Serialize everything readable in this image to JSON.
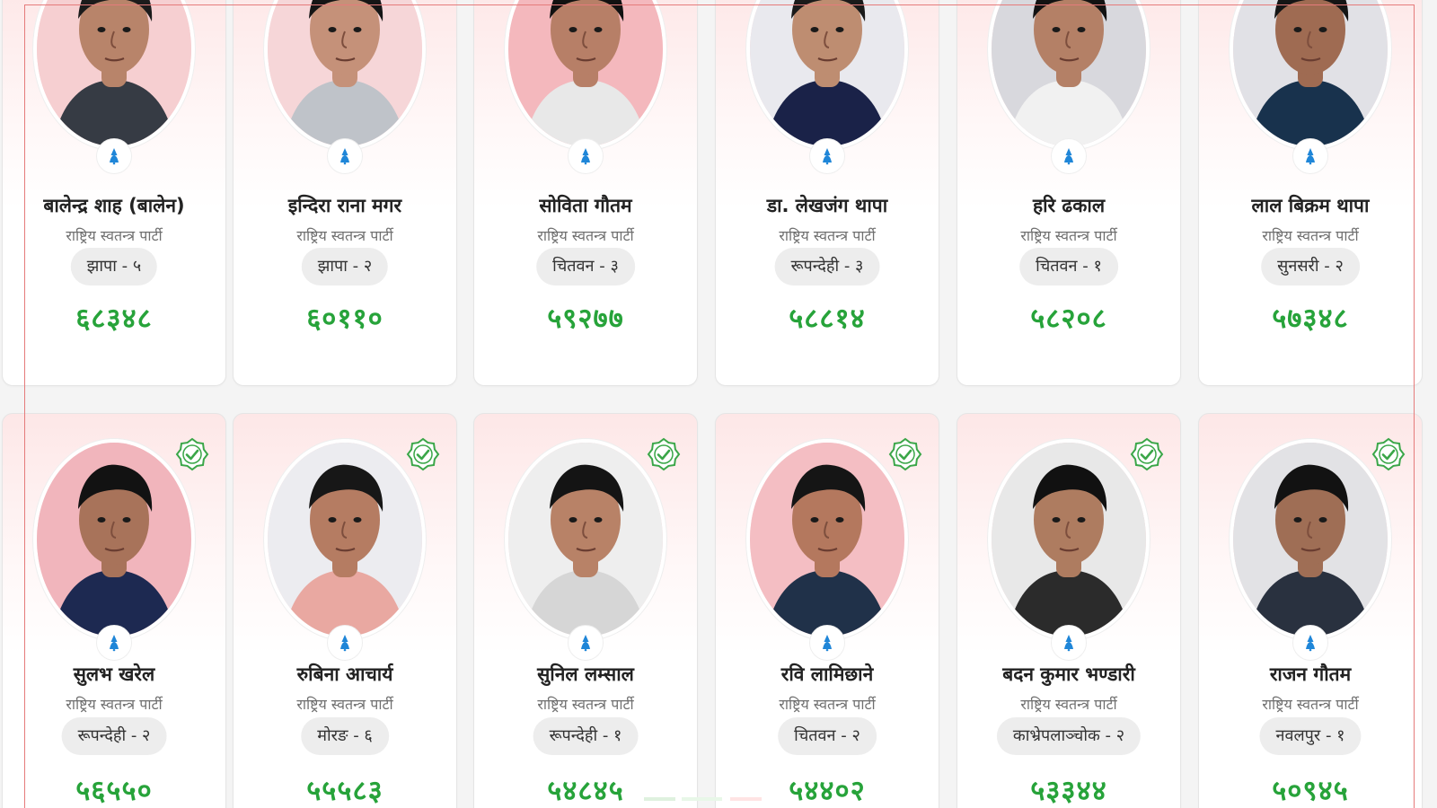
{
  "colors": {
    "card_tint": "#fde7e7",
    "vote_green": "#27a33a",
    "badge_bg": "#ededed",
    "verified_green": "#3aa648",
    "party_blue": "#1f86d8",
    "frame_red": "#e57b7b"
  },
  "cards": [
    {
      "name": "बालेन्द्र शाह (बालेन)",
      "party": "राष्ट्रिय स्वतन्त्र पार्टी",
      "constituency": "झापा - ५",
      "votes": "६८३४८",
      "photo_bg": "#f6cfd1",
      "skin": "#b8846a",
      "hair": "#1b1b1b",
      "shirt": "#363b44"
    },
    {
      "name": "इन्दिरा राना मगर",
      "party": "राष्ट्रिय स्वतन्त्र पार्टी",
      "constituency": "झापा - २",
      "votes": "६०११०",
      "photo_bg": "#f6d6d8",
      "skin": "#c59179",
      "hair": "#151515",
      "shirt": "#bfc3c9"
    },
    {
      "name": "सोविता गौतम",
      "party": "राष्ट्रिय स्वतन्त्र पार्टी",
      "constituency": "चितवन - ३",
      "votes": "५९२७७",
      "photo_bg": "#f4b8bd",
      "skin": "#b77f67",
      "hair": "#111111",
      "shirt": "#e8e8e8"
    },
    {
      "name": "डा. लेखजंग थापा",
      "party": "राष्ट्रिय स्वतन्त्र पार्टी",
      "constituency": "रूपन्देही - ३",
      "votes": "५८८१४",
      "photo_bg": "#e9e9ee",
      "skin": "#be8d71",
      "hair": "#1a1a1a",
      "shirt": "#1a2248"
    },
    {
      "name": "हरि ढकाल",
      "party": "राष्ट्रिय स्वतन्त्र पार्टी",
      "constituency": "चितवन - १",
      "votes": "५८२०८",
      "photo_bg": "#d8d8dd",
      "skin": "#b48066",
      "hair": "#121212",
      "shirt": "#f1f1f1"
    },
    {
      "name": "लाल बिक्रम थापा",
      "party": "राष्ट्रिय स्वतन्त्र पार्टी",
      "constituency": "सुनसरी - २",
      "votes": "५७३४८",
      "photo_bg": "#e1e1e6",
      "skin": "#9f6b52",
      "hair": "#151515",
      "shirt": "#18324d"
    },
    {
      "name": "सुलभ खरेल",
      "party": "राष्ट्रिय स्वतन्त्र पार्टी",
      "constituency": "रूपन्देही - २",
      "votes": "५६५५०",
      "photo_bg": "#f1b5bc",
      "skin": "#a8735a",
      "hair": "#121212",
      "shirt": "#1d2951"
    },
    {
      "name": "रुबिना आचार्य",
      "party": "राष्ट्रिय स्वतन्त्र पार्टी",
      "constituency": "मोरङ - ६",
      "votes": "५५५८३",
      "photo_bg": "#ececf0",
      "skin": "#b57c62",
      "hair": "#171717",
      "shirt": "#e9a8a1"
    },
    {
      "name": "सुनिल लम्साल",
      "party": "राष्ट्रिय स्वतन्त्र पार्टी",
      "constituency": "रूपन्देही - १",
      "votes": "५४८४५",
      "photo_bg": "#eeeeee",
      "skin": "#b88267",
      "hair": "#141414",
      "shirt": "#d6d6d6"
    },
    {
      "name": "रवि लामिछाने",
      "party": "राष्ट्रिय स्वतन्त्र पार्टी",
      "constituency": "चितवन - २",
      "votes": "५४४०२",
      "photo_bg": "#f4bec3",
      "skin": "#b4785e",
      "hair": "#151515",
      "shirt": "#203149"
    },
    {
      "name": "बदन कुमार भण्डारी",
      "party": "राष्ट्रिय स्वतन्त्र पार्टी",
      "constituency": "काभ्रेपलाञ्चोक - २",
      "votes": "५३३४४",
      "photo_bg": "#e8e8e8",
      "skin": "#ae7c60",
      "hair": "#111111",
      "shirt": "#2b2b2b"
    },
    {
      "name": "राजन गौतम",
      "party": "राष्ट्रिय स्वतन्त्र पार्टी",
      "constituency": "नवलपुर - १",
      "votes": "५०९४५",
      "photo_bg": "#e2e2e5",
      "skin": "#9f6e55",
      "hair": "#121212",
      "shirt": "#29313f"
    }
  ]
}
